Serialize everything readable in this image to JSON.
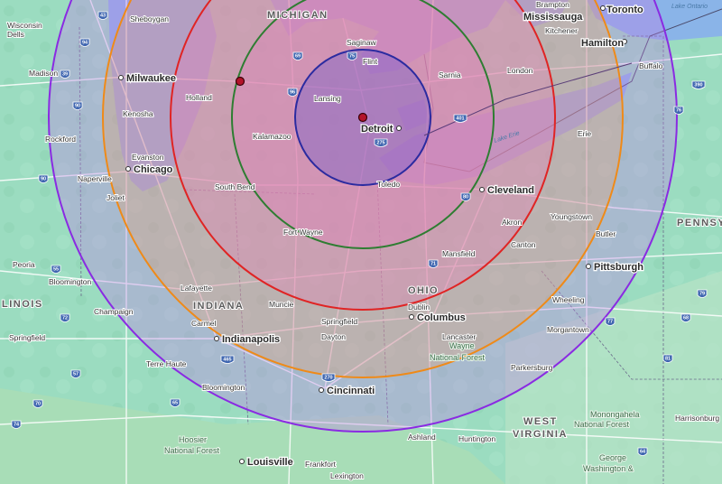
{
  "map": {
    "regions": [
      {
        "name": "michigan",
        "label": "MICHIGAN"
      },
      {
        "name": "indiana",
        "label": "INDIANA"
      },
      {
        "name": "ohio",
        "label": "OHIO"
      },
      {
        "name": "illinois",
        "label": "LINOIS"
      },
      {
        "name": "pennsylvania",
        "label": "PENNSY"
      },
      {
        "name": "west-virginia-1",
        "label": "WEST"
      },
      {
        "name": "west-virginia-2",
        "label": "VIRGINIA"
      }
    ],
    "major_cities": [
      {
        "name": "detroit",
        "label": "Detroit"
      },
      {
        "name": "milwaukee",
        "label": "Milwaukee"
      },
      {
        "name": "chicago",
        "label": "Chicago"
      },
      {
        "name": "toronto",
        "label": "Toronto"
      },
      {
        "name": "cleveland",
        "label": "Cleveland"
      },
      {
        "name": "columbus",
        "label": "Columbus"
      },
      {
        "name": "indianapolis",
        "label": "Indianapolis"
      },
      {
        "name": "cincinnati",
        "label": "Cincinnati"
      },
      {
        "name": "pittsburgh",
        "label": "Pittsburgh"
      },
      {
        "name": "louisville",
        "label": "Louisville"
      },
      {
        "name": "mississauga",
        "label": "Mississauga"
      },
      {
        "name": "hamilton",
        "label": "Hamilton"
      }
    ],
    "cities": [
      {
        "name": "wisconsin-dells-1",
        "label": "Wisconsin"
      },
      {
        "name": "wisconsin-dells-2",
        "label": "Dells"
      },
      {
        "name": "sheboygan",
        "label": "Sheboygan"
      },
      {
        "name": "madison",
        "label": "Madison"
      },
      {
        "name": "kenosha",
        "label": "Kenosha"
      },
      {
        "name": "rockford",
        "label": "Rockford"
      },
      {
        "name": "evanston",
        "label": "Evanston"
      },
      {
        "name": "naperville",
        "label": "Naperville"
      },
      {
        "name": "joliet",
        "label": "Joliet"
      },
      {
        "name": "peoria",
        "label": "Peoria"
      },
      {
        "name": "bloomington-il",
        "label": "Bloomington"
      },
      {
        "name": "champaign",
        "label": "Champaign"
      },
      {
        "name": "springfield-il",
        "label": "Springfield"
      },
      {
        "name": "holland",
        "label": "Holland"
      },
      {
        "name": "kalamazoo",
        "label": "Kalamazoo"
      },
      {
        "name": "lansing",
        "label": "Lansing"
      },
      {
        "name": "saginaw",
        "label": "Saginaw"
      },
      {
        "name": "flint",
        "label": "Flint"
      },
      {
        "name": "sarnia",
        "label": "Sarnia"
      },
      {
        "name": "london",
        "label": "London"
      },
      {
        "name": "kitchener",
        "label": "Kitchener"
      },
      {
        "name": "brampton",
        "label": "Brampton"
      },
      {
        "name": "buffalo",
        "label": "Buffalo"
      },
      {
        "name": "south-bend",
        "label": "South Bend"
      },
      {
        "name": "toledo",
        "label": "Toledo"
      },
      {
        "name": "fort-wayne",
        "label": "Fort Wayne"
      },
      {
        "name": "erie",
        "label": "Erie"
      },
      {
        "name": "akron",
        "label": "Akron"
      },
      {
        "name": "canton",
        "label": "Canton"
      },
      {
        "name": "youngstown",
        "label": "Youngstown"
      },
      {
        "name": "butler",
        "label": "Butler"
      },
      {
        "name": "mansfield",
        "label": "Mansfield"
      },
      {
        "name": "lafayette",
        "label": "Lafayette"
      },
      {
        "name": "muncie",
        "label": "Muncie"
      },
      {
        "name": "carmel",
        "label": "Carmel"
      },
      {
        "name": "springfield-oh",
        "label": "Springfield"
      },
      {
        "name": "dublin",
        "label": "Dublin"
      },
      {
        "name": "dayton",
        "label": "Dayton"
      },
      {
        "name": "lancaster",
        "label": "Lancaster"
      },
      {
        "name": "wheeling",
        "label": "Wheeling"
      },
      {
        "name": "morgantown",
        "label": "Morgantown"
      },
      {
        "name": "parkersburg",
        "label": "Parkersburg"
      },
      {
        "name": "terre-haute",
        "label": "Terre Haute"
      },
      {
        "name": "bloomington-in",
        "label": "Bloomington"
      },
      {
        "name": "ashland",
        "label": "Ashland"
      },
      {
        "name": "huntington",
        "label": "Huntington"
      },
      {
        "name": "frankfort",
        "label": "Frankfort"
      },
      {
        "name": "lexington",
        "label": "Lexington"
      },
      {
        "name": "harrisonburg",
        "label": "Harrisonburg"
      }
    ],
    "forests": [
      {
        "name": "wayne-nf-1",
        "label": "Wayne"
      },
      {
        "name": "wayne-nf-2",
        "label": "National Forest"
      },
      {
        "name": "hoosier-nf-1",
        "label": "Hoosier"
      },
      {
        "name": "hoosier-nf-2",
        "label": "National Forest"
      },
      {
        "name": "monongahela-nf-1",
        "label": "Monongahela"
      },
      {
        "name": "monongahela-nf-2",
        "label": "National Forest"
      },
      {
        "name": "george-washington-nf-1",
        "label": "George"
      },
      {
        "name": "george-washington-nf-2",
        "label": "Washington &"
      }
    ],
    "water": [
      {
        "name": "lake-ontario",
        "label": "Lake Ontario"
      },
      {
        "name": "lake-erie",
        "label": "Lake Erie"
      }
    ],
    "highway_shields": [
      "94",
      "43",
      "39",
      "90",
      "55",
      "74",
      "72",
      "57",
      "70",
      "65",
      "69",
      "96",
      "75",
      "80",
      "71",
      "76",
      "79",
      "68",
      "77",
      "81",
      "64",
      "390",
      "401",
      "275",
      "270",
      "465",
      "90"
    ],
    "radius_rings": [
      {
        "name": "ring-blue",
        "color": "#2b2ba0",
        "fill": "#3b3bd6"
      },
      {
        "name": "ring-green",
        "color": "#2e7d32",
        "fill": "#e07ab8"
      },
      {
        "name": "ring-red",
        "color": "#e02424",
        "fill": "#e87fb6"
      },
      {
        "name": "ring-orange",
        "color": "#ef8a18",
        "fill": "#e9a06a"
      },
      {
        "name": "ring-purple",
        "color": "#8a2be2",
        "fill": "#c07ae8"
      }
    ],
    "markers": [
      {
        "name": "marker-detroit",
        "color": "#b3142a"
      },
      {
        "name": "marker-holland",
        "color": "#b3142a"
      }
    ],
    "colors": {
      "land": "#9bdcc0",
      "water": "#8ab4e8",
      "road": "#ffffff",
      "interstate": "#3f66b0",
      "border": "#5b4b8a"
    }
  }
}
